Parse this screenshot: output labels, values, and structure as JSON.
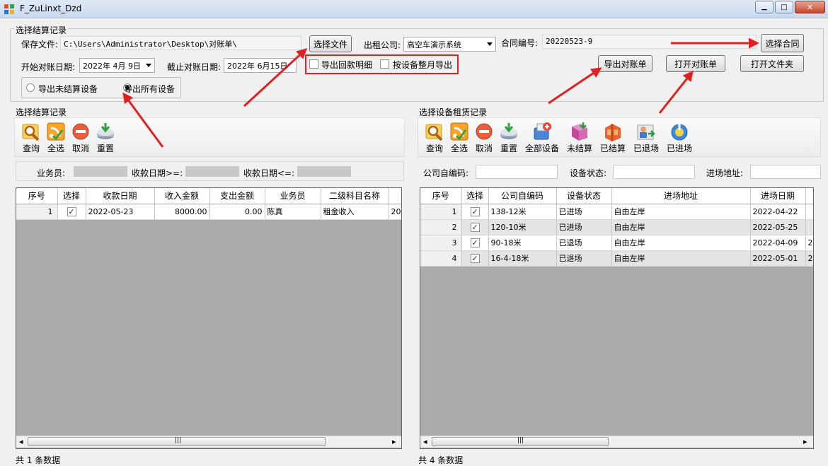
{
  "window": {
    "title": "F_ZuLinxt_Dzd",
    "min_glyph": "▁",
    "max_glyph": "□",
    "close_glyph": "✕"
  },
  "settlement": {
    "group_title": "选择结算记录",
    "save_file_label": "保存文件:",
    "save_file_value": "C:\\Users\\Administrator\\Desktop\\对账单\\",
    "choose_file_button": "选择文件",
    "rental_company_label": "出租公司:",
    "rental_company_value": "高空车演示系统",
    "contract_no_label": "合同编号:",
    "contract_no_value": "20220523-9",
    "choose_contract_button": "选择合同",
    "start_date_label": "开始对账日期:",
    "start_date_value": "2022年 4月 9日",
    "end_date_label": "截止对账日期:",
    "end_date_value": "2022年 6月15日",
    "export_payback_label": "导出回款明细",
    "export_month_label": "按设备整月导出",
    "export_statement_button": "导出对账单",
    "open_statement_button": "打开对账单",
    "open_folder_button": "打开文件夹",
    "radio_unsettled_label": "导出未结算设备",
    "radio_all_label": "导出所有设备"
  },
  "left_panel": {
    "title": "选择结算记录",
    "tools": [
      "查询",
      "全选",
      "取消",
      "重置"
    ],
    "filter_salesman_label": "业务员:",
    "filter_date_from_label": "收款日期>=:",
    "filter_date_to_label": "收款日期<=:",
    "columns": [
      "序号",
      "选择",
      "收款日期",
      "收入金额",
      "支出金额",
      "业务员",
      "二级科目名称",
      ""
    ],
    "rows": [
      {
        "no": "1",
        "checked": true,
        "date": "2022-05-23",
        "income": "8000.00",
        "expense": "0.00",
        "salesman": "陈真",
        "subject": "租金收入",
        "extra": "20"
      }
    ],
    "status": "共 1 条数据"
  },
  "right_panel": {
    "title": "选择设备租赁记录",
    "tools": [
      "查询",
      "全选",
      "取消",
      "重置",
      "全部设备",
      "未结算",
      "已结算",
      "已退场",
      "已进场"
    ],
    "filter_code_label": "公司自编码:",
    "filter_status_label": "设备状态:",
    "filter_address_label": "进场地址:",
    "columns": [
      "序号",
      "选择",
      "公司自编码",
      "设备状态",
      "进场地址",
      "进场日期",
      ""
    ],
    "rows": [
      {
        "no": "1",
        "checked": true,
        "code": "138-12米",
        "status": "已进场",
        "address": "自由左岸",
        "date": "2022-04-22",
        "extra": ""
      },
      {
        "no": "2",
        "checked": true,
        "code": "120-10米",
        "status": "已进场",
        "address": "自由左岸",
        "date": "2022-05-25",
        "extra": ""
      },
      {
        "no": "3",
        "checked": true,
        "code": "90-18米",
        "status": "已退场",
        "address": "自由左岸",
        "date": "2022-04-09",
        "extra": "2"
      },
      {
        "no": "4",
        "checked": true,
        "code": "16-4-18米",
        "status": "已退场",
        "address": "自由左岸",
        "date": "2022-05-01",
        "extra": "2"
      }
    ],
    "status": "共 4 条数据"
  },
  "scroll_glyphs": {
    "left": "◂",
    "right": "▸",
    "grip": "|||"
  },
  "colors": {
    "annotation_red": "#e02020",
    "grid_background": "#ababab"
  }
}
